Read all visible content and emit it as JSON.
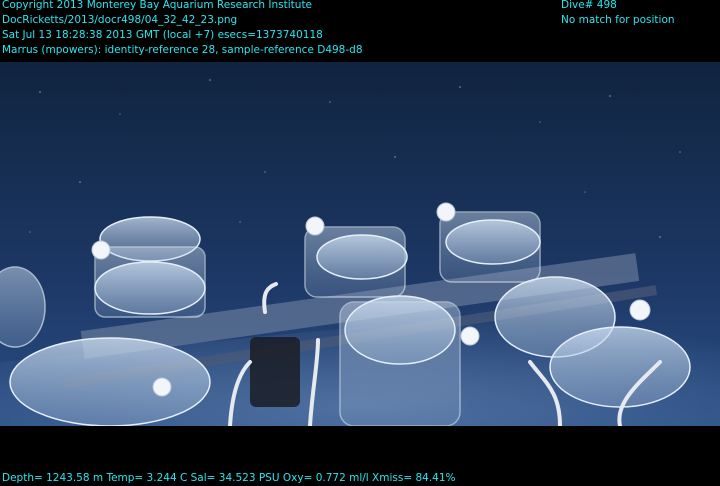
{
  "overlay": {
    "copyright": "Copyright 2013 Monterey Bay Aquarium Research Institute",
    "file_path": "DocRicketts/2013/docr498/04_32_42_23.png",
    "timestamp": "Sat Jul 13 18:28:38 2013 GMT (local +7)  esecs=1373740118",
    "annotation": "Marrus (mpowers): identity-reference 28, sample-reference D498-d8",
    "dive": "Dive# 498",
    "position_status": "No match for position",
    "telemetry": "Depth= 1243.58 m  Temp= 3.244 C  Sal= 34.523 PSU  Oxy= 0.772 ml/l  Xmiss= 84.41%"
  },
  "colors": {
    "overlay_text": "#27e6ef",
    "water_top": "#10243f",
    "water_bottom": "#2a4e86"
  }
}
